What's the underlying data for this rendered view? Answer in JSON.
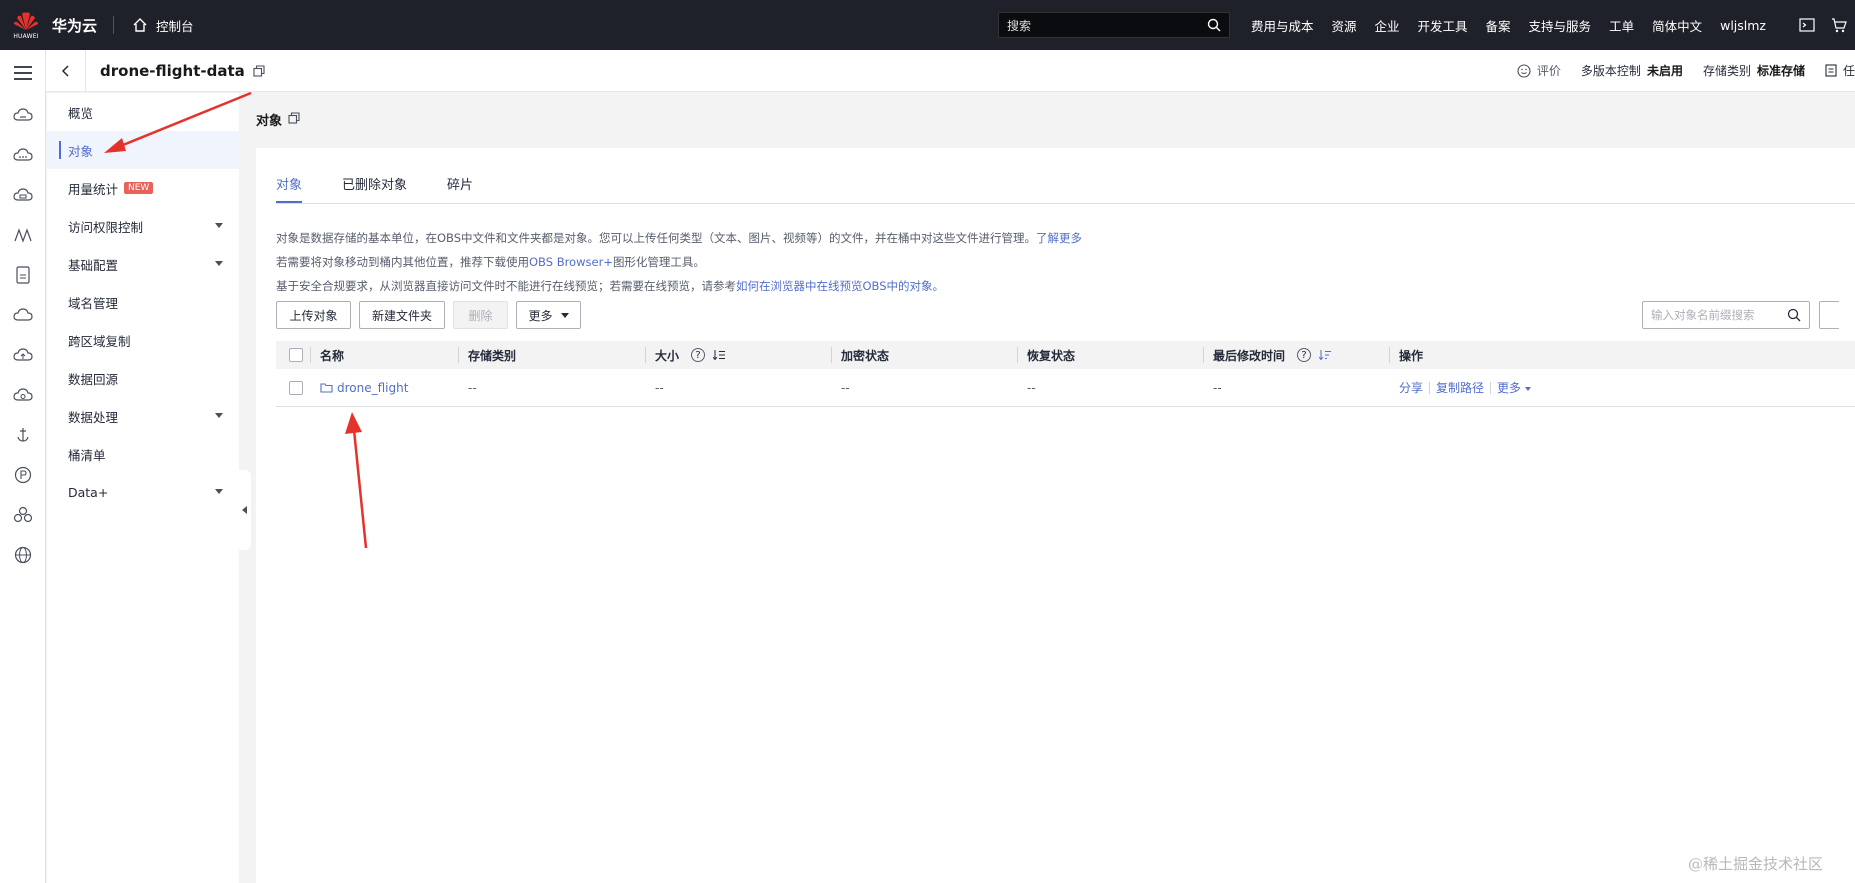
{
  "topbar": {
    "logo_text": "HUAWEI",
    "brand": "华为云",
    "console": "控制台",
    "search_placeholder": "搜索",
    "nav": [
      "费用与成本",
      "资源",
      "企业",
      "开发工具",
      "备案",
      "支持与服务",
      "工单",
      "简体中文",
      "wljslmz"
    ]
  },
  "header": {
    "bucket_name": "drone-flight-data",
    "rate": "评价",
    "version_label": "多版本控制",
    "version_value": "未启用",
    "storage_label": "存储类别",
    "storage_value": "标准存储",
    "task_label": "任"
  },
  "subnav": {
    "items": [
      {
        "label": "概览"
      },
      {
        "label": "对象"
      },
      {
        "label": "用量统计",
        "badge": "NEW"
      },
      {
        "label": "访问权限控制"
      },
      {
        "label": "基础配置"
      },
      {
        "label": "域名管理"
      },
      {
        "label": "跨区域复制"
      },
      {
        "label": "数据回源"
      },
      {
        "label": "数据处理"
      },
      {
        "label": "桶清单"
      },
      {
        "label": "Data+"
      }
    ]
  },
  "main": {
    "title": "对象",
    "tabs": [
      "对象",
      "已删除对象",
      "碎片"
    ],
    "notes": {
      "line1": "对象是数据存储的基本单位，在OBS中文件和文件夹都是对象。您可以上传任何类型（文本、图片、视频等）的文件，并在桶中对这些文件进行管理。",
      "line1_link": "了解更多",
      "line2_pre": "若需要将对象移动到桶内其他位置，推荐下载使用",
      "line2_link": "OBS Browser+",
      "line2_post": "图形化管理工具。",
      "line3_pre": "基于安全合规要求，从浏览器直接访问文件时不能进行在线预览；若需要在线预览，请参考",
      "line3_link": "如何在浏览器中在线预览OBS中的对象。"
    },
    "buttons": {
      "upload": "上传对象",
      "new_folder": "新建文件夹",
      "delete": "删除",
      "more": "更多"
    },
    "search_placeholder": "输入对象名前缀搜索",
    "columns": [
      "名称",
      "存储类别",
      "大小",
      "加密状态",
      "恢复状态",
      "最后修改时间",
      "操作"
    ],
    "rows": [
      {
        "name": "drone_flight",
        "storage": "--",
        "size": "--",
        "encryption": "--",
        "restore": "--",
        "modified": "--"
      }
    ],
    "ops": {
      "share": "分享",
      "copy_path": "复制路径",
      "more": "更多"
    }
  },
  "watermark": "@稀土掘金技术社区",
  "colors": {
    "accent": "#526ecc",
    "topbar": "#1e2129",
    "annotation": "#e5322d",
    "badge": "#e8625a"
  }
}
